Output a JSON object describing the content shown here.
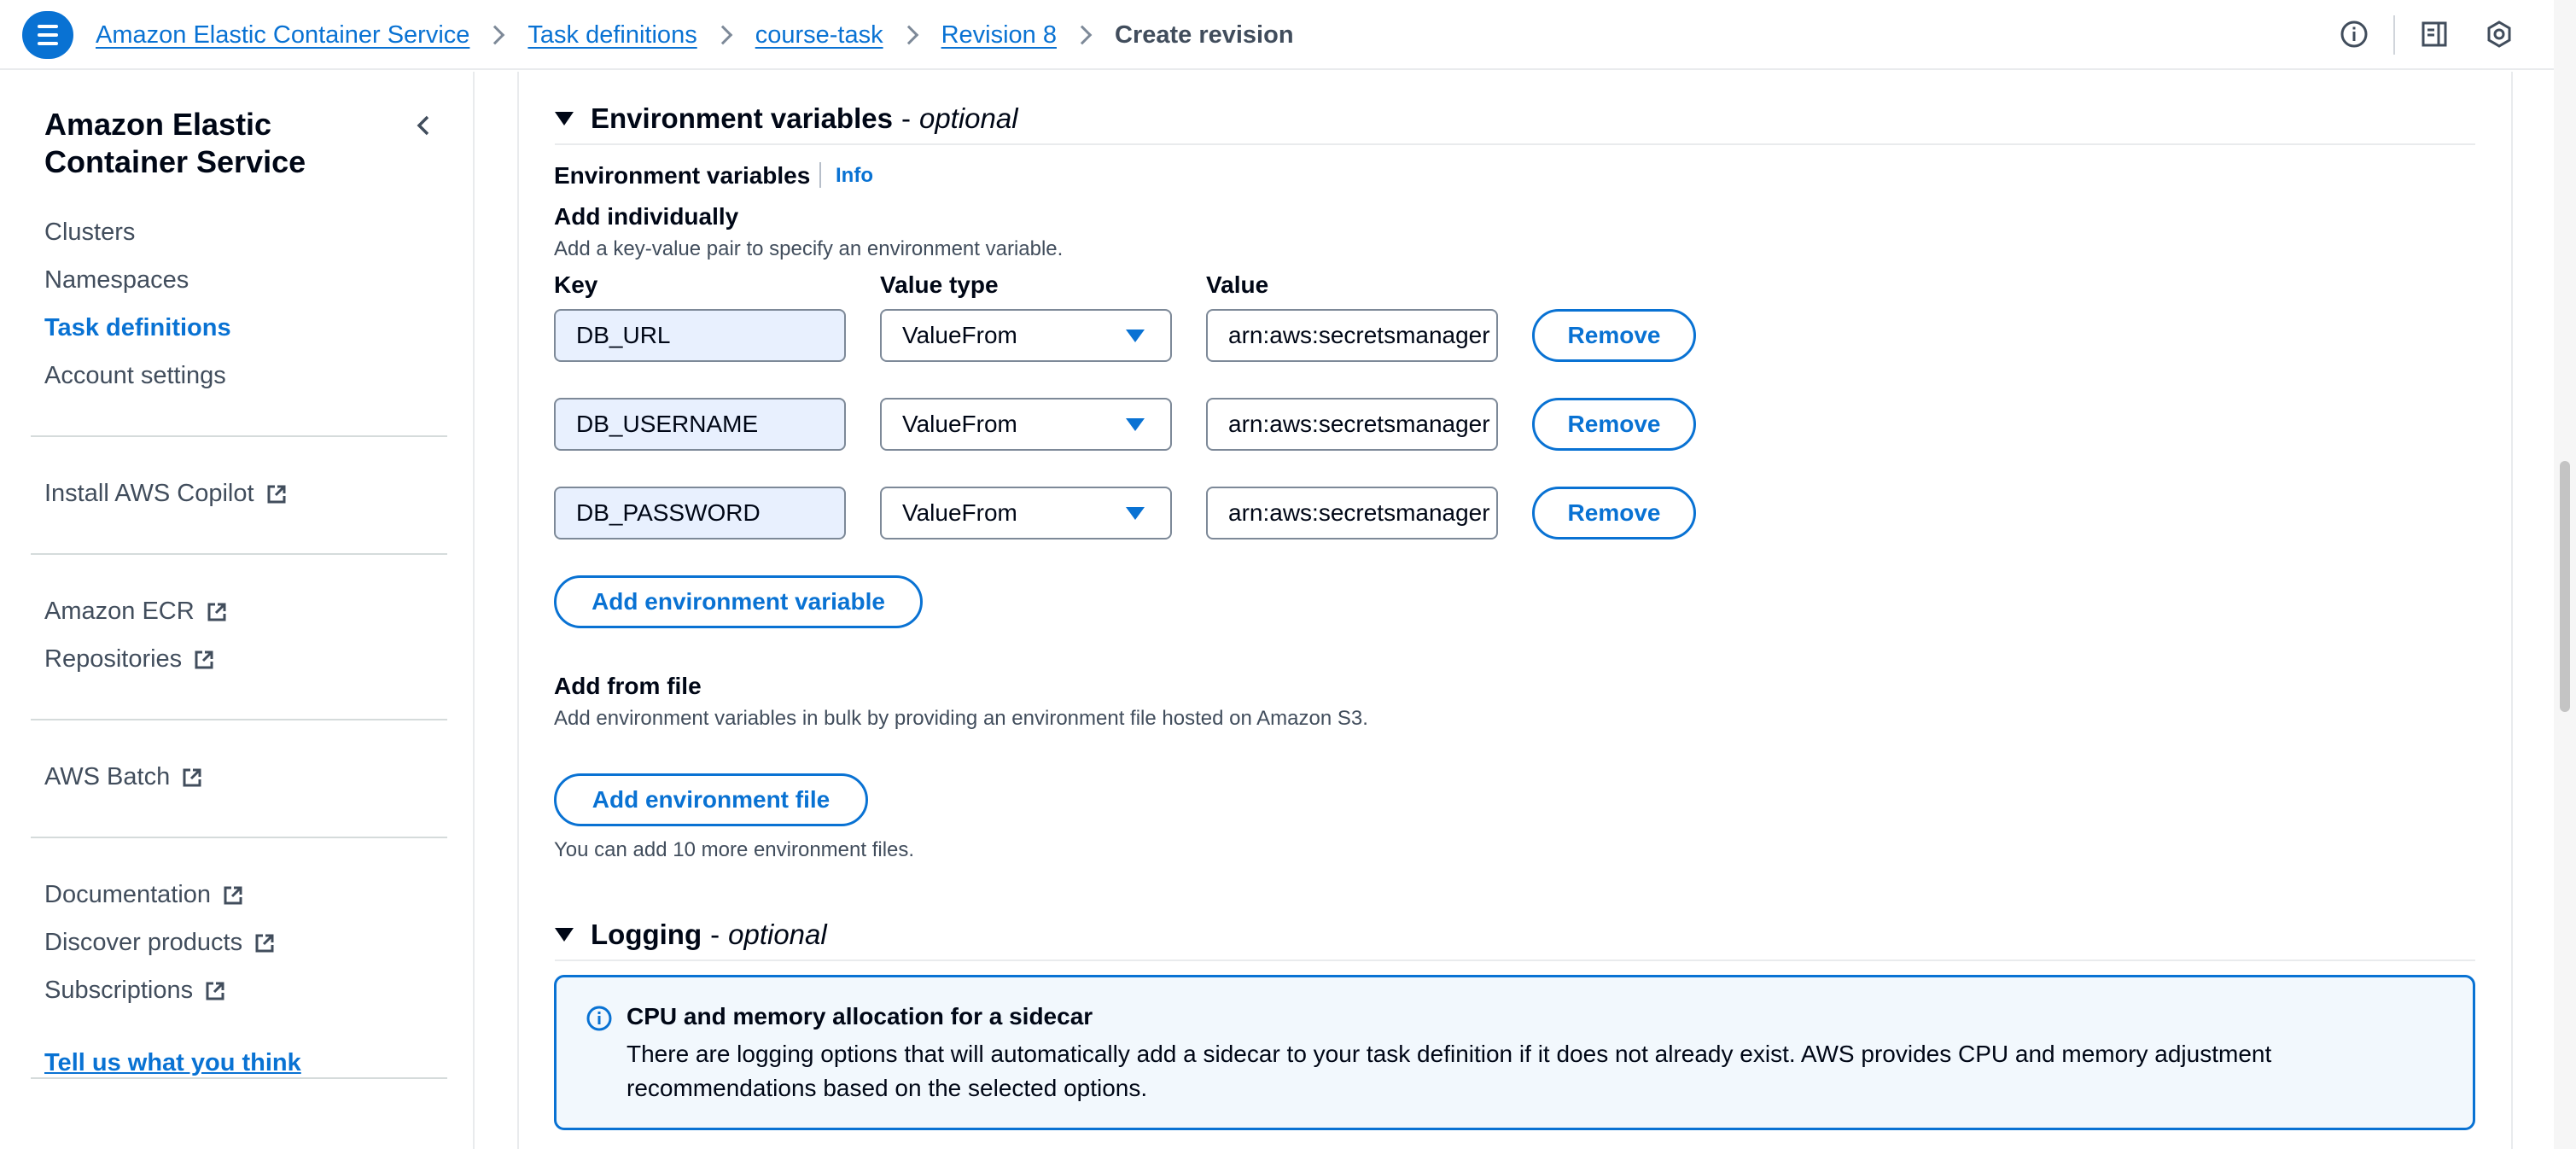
{
  "breadcrumbs": {
    "items": [
      "Amazon Elastic Container Service",
      "Task definitions",
      "course-task",
      "Revision 8"
    ],
    "current": "Create revision"
  },
  "top_icons": [
    "info-circle-icon",
    "side-panel-icon",
    "settings-hex-icon"
  ],
  "sidebar": {
    "title_line1": "Amazon Elastic",
    "title_line2": "Container Service",
    "nav": [
      "Clusters",
      "Namespaces",
      "Task definitions",
      "Account settings"
    ],
    "active": "Task definitions",
    "copilot": "Install AWS Copilot",
    "ecr": [
      "Amazon ECR",
      "Repositories"
    ],
    "batch": "AWS Batch",
    "resources": [
      "Documentation",
      "Discover products",
      "Subscriptions"
    ],
    "feedback": "Tell us what you think"
  },
  "env_section": {
    "title": "Environment variables",
    "optional": "optional",
    "dash": "-",
    "label": "Environment variables",
    "info": "Info",
    "add_individually": "Add individually",
    "add_individually_desc": "Add a key-value pair to specify an environment variable.",
    "col_key": "Key",
    "col_type": "Value type",
    "col_value": "Value",
    "rows": [
      {
        "key": "DB_URL",
        "type": "ValueFrom",
        "value": "arn:aws:secretsmanager",
        "remove": "Remove"
      },
      {
        "key": "DB_USERNAME",
        "type": "ValueFrom",
        "value": "arn:aws:secretsmanager",
        "remove": "Remove"
      },
      {
        "key": "DB_PASSWORD",
        "type": "ValueFrom",
        "value": "arn:aws:secretsmanager",
        "remove": "Remove"
      }
    ],
    "add_var_button": "Add environment variable",
    "add_from_file": "Add from file",
    "add_from_file_desc": "Add environment variables in bulk by providing an environment file hosted on Amazon S3.",
    "add_file_button": "Add environment file",
    "files_remaining": "You can add 10 more environment files."
  },
  "logging_section": {
    "title": "Logging",
    "dash": "-",
    "optional": "optional",
    "alert_title": "CPU and memory allocation for a sidecar",
    "alert_body": "There are logging options that will automatically add a sidecar to your task definition if it does not already exist. AWS provides CPU and memory adjustment recommendations based on the selected options."
  },
  "colors": {
    "link": "#0972d3",
    "text": "#000716",
    "muted": "#414d5c",
    "autofill_bg": "#e8f0fe",
    "alert_bg": "#f2f8fd"
  }
}
